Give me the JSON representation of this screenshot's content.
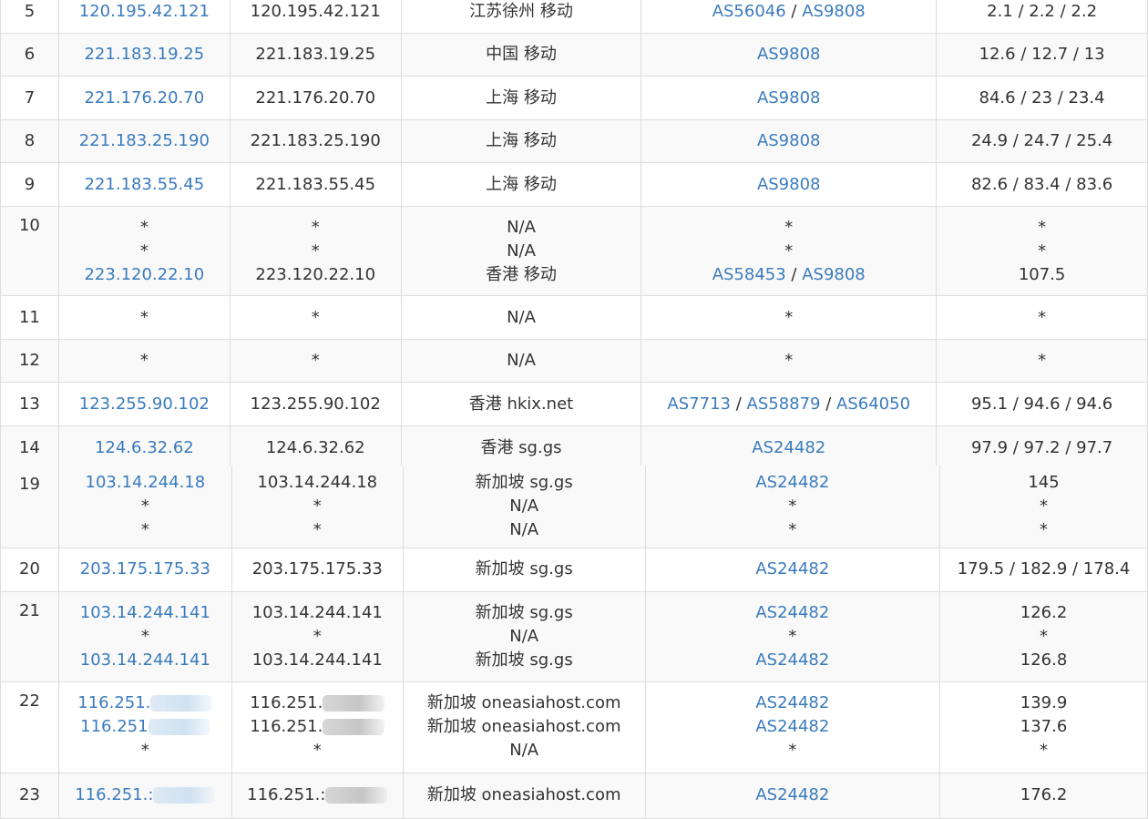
{
  "table_top": {
    "rows": [
      {
        "hop": "5",
        "ip": [
          "120.195.42.121"
        ],
        "host": [
          "120.195.42.121"
        ],
        "loc": [
          "江苏徐州 移动"
        ],
        "as": [
          [
            "AS56046",
            "AS9808"
          ]
        ],
        "rtt": [
          "2.1 / 2.2 / 2.2"
        ],
        "h": 48
      },
      {
        "hop": "6",
        "ip": [
          "221.183.19.25"
        ],
        "host": [
          "221.183.19.25"
        ],
        "loc": [
          "中国 移动"
        ],
        "as": [
          [
            "AS9808"
          ]
        ],
        "rtt": [
          "12.6 / 12.7 / 13"
        ],
        "h": 47
      },
      {
        "hop": "7",
        "ip": [
          "221.176.20.70"
        ],
        "host": [
          "221.176.20.70"
        ],
        "loc": [
          "上海 移动"
        ],
        "as": [
          [
            "AS9808"
          ]
        ],
        "rtt": [
          "84.6 / 23 / 23.4"
        ],
        "h": 48
      },
      {
        "hop": "8",
        "ip": [
          "221.183.25.190"
        ],
        "host": [
          "221.183.25.190"
        ],
        "loc": [
          "上海 移动"
        ],
        "as": [
          [
            "AS9808"
          ]
        ],
        "rtt": [
          "24.9 / 24.7 / 25.4"
        ],
        "h": 47
      },
      {
        "hop": "9",
        "ip": [
          "221.183.55.45"
        ],
        "host": [
          "221.183.55.45"
        ],
        "loc": [
          "上海 移动"
        ],
        "as": [
          [
            "AS9808"
          ]
        ],
        "rtt": [
          "82.6 / 83.4 / 83.6"
        ],
        "h": 48
      },
      {
        "hop": "10",
        "ip": [
          "*",
          "*",
          "223.120.22.10"
        ],
        "host": [
          "*",
          "*",
          "223.120.22.10"
        ],
        "loc": [
          "N/A",
          "N/A",
          "香港 移动"
        ],
        "as": [
          [
            "*"
          ],
          [
            "*"
          ],
          [
            "AS58453",
            "AS9808"
          ]
        ],
        "rtt": [
          "*",
          "*",
          "107.5"
        ],
        "h": 98
      },
      {
        "hop": "11",
        "ip": [
          "*"
        ],
        "host": [
          "*"
        ],
        "loc": [
          "N/A"
        ],
        "as": [
          [
            "*"
          ]
        ],
        "rtt": [
          "*"
        ],
        "h": 48
      },
      {
        "hop": "12",
        "ip": [
          "*"
        ],
        "host": [
          "*"
        ],
        "loc": [
          "N/A"
        ],
        "as": [
          [
            "*"
          ]
        ],
        "rtt": [
          "*"
        ],
        "h": 47
      },
      {
        "hop": "13",
        "ip": [
          "123.255.90.102"
        ],
        "host": [
          "123.255.90.102"
        ],
        "loc": [
          "香港 hkix.net"
        ],
        "as": [
          [
            "AS7713",
            "AS58879",
            "AS64050"
          ]
        ],
        "rtt": [
          "95.1 / 94.6 / 94.6"
        ],
        "h": 48
      },
      {
        "hop": "14",
        "ip": [
          "124.6.32.62"
        ],
        "host": [
          "124.6.32.62"
        ],
        "loc": [
          "香港 sg.gs"
        ],
        "as": [
          [
            "AS24482"
          ]
        ],
        "rtt": [
          "97.9 / 97.2 / 97.7"
        ],
        "h": 48
      }
    ]
  },
  "table_bottom": {
    "rows": [
      {
        "hop": "19",
        "ip": [
          "103.14.244.18",
          "*",
          "*"
        ],
        "host": [
          "103.14.244.18",
          "*",
          "*"
        ],
        "loc": [
          "新加坡 sg.gs",
          "N/A",
          "N/A"
        ],
        "as": [
          [
            "AS24482"
          ],
          [
            "*"
          ],
          [
            "*"
          ]
        ],
        "rtt": [
          "145",
          "*",
          "*"
        ],
        "h": 90
      },
      {
        "hop": "20",
        "ip": [
          "203.175.175.33"
        ],
        "host": [
          "203.175.175.33"
        ],
        "loc": [
          "新加坡 sg.gs"
        ],
        "as": [
          [
            "AS24482"
          ]
        ],
        "rtt": [
          "179.5 / 182.9 / 178.4"
        ],
        "h": 48
      },
      {
        "hop": "21",
        "ip": [
          "103.14.244.141",
          "*",
          "103.14.244.141"
        ],
        "host": [
          "103.14.244.141",
          "*",
          "103.14.244.141"
        ],
        "loc": [
          "新加坡 sg.gs",
          "N/A",
          "新加坡 sg.gs"
        ],
        "as": [
          [
            "AS24482"
          ],
          [
            "*"
          ],
          [
            "AS24482"
          ]
        ],
        "rtt": [
          "126.2",
          "*",
          "126.8"
        ],
        "h": 99
      },
      {
        "hop": "22",
        "ip": [
          "116.251.",
          "116.251",
          "*"
        ],
        "host": [
          "116.251.",
          "116.251.",
          "*"
        ],
        "loc": [
          "新加坡 oneasiahost.com",
          "新加坡 oneasiahost.com",
          "N/A"
        ],
        "as": [
          [
            "AS24482"
          ],
          [
            "AS24482"
          ],
          [
            "*"
          ]
        ],
        "rtt": [
          "139.9",
          "137.6",
          "*"
        ],
        "h": 100
      },
      {
        "hop": "23",
        "ip": [
          "116.251.:"
        ],
        "host": [
          "116.251.:"
        ],
        "loc": [
          "新加坡 oneasiahost.com"
        ],
        "as": [
          [
            "AS24482"
          ]
        ],
        "rtt": [
          "176.2"
        ],
        "h": 50
      }
    ]
  }
}
